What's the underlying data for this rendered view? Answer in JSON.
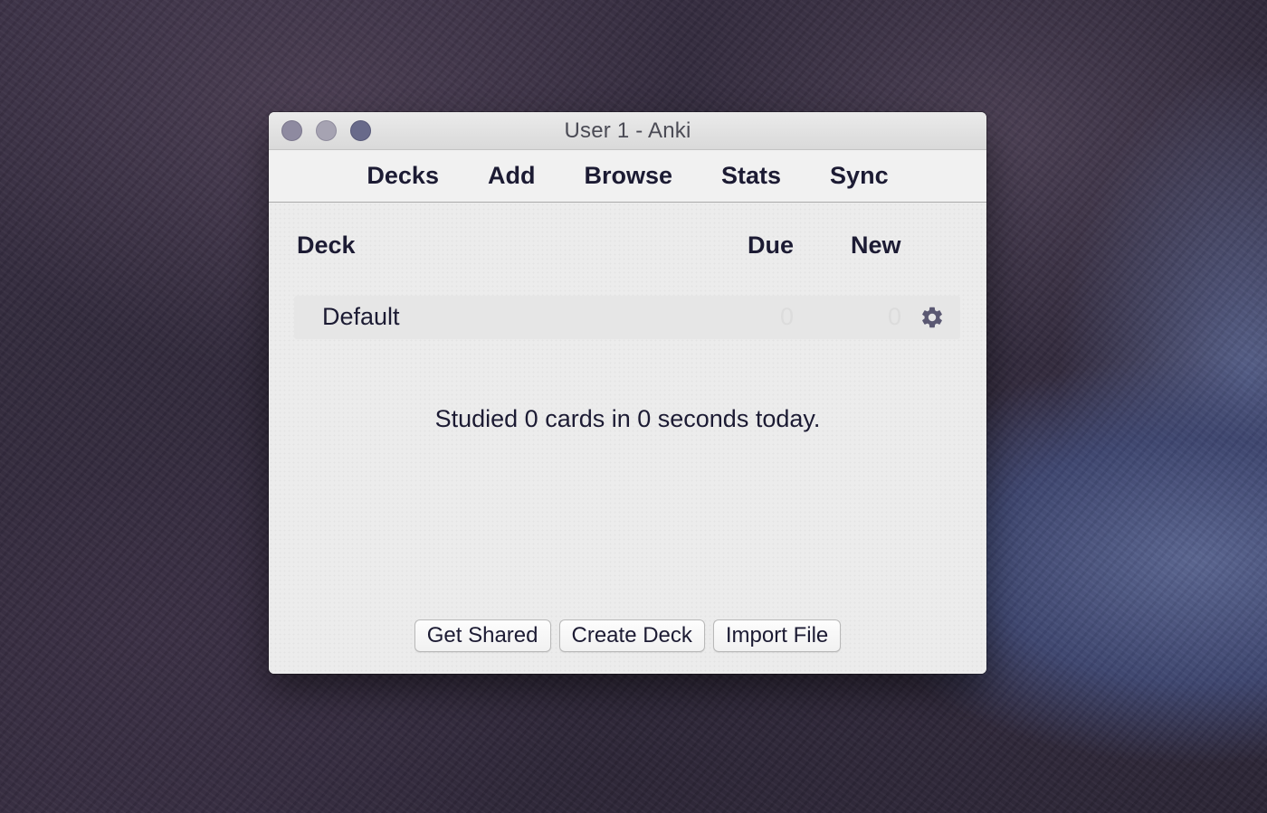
{
  "window": {
    "title": "User 1 - Anki"
  },
  "toolbar": {
    "items": [
      {
        "label": "Decks"
      },
      {
        "label": "Add"
      },
      {
        "label": "Browse"
      },
      {
        "label": "Stats"
      },
      {
        "label": "Sync"
      }
    ]
  },
  "deck_list": {
    "headers": {
      "deck": "Deck",
      "due": "Due",
      "new": "New"
    },
    "rows": [
      {
        "name": "Default",
        "due": "0",
        "new": "0",
        "options_icon": "gear-icon"
      }
    ]
  },
  "summary": {
    "studied_text": "Studied 0 cards in 0 seconds today."
  },
  "actions": {
    "get_shared": "Get Shared",
    "create_deck": "Create Deck",
    "import_file": "Import File"
  },
  "colors": {
    "text": "#1c1b33",
    "window_bg": "#ececec",
    "close_button": "#8e8aa0",
    "minimize_button": "#a6a3b2",
    "zoom_button": "#686a8a"
  }
}
